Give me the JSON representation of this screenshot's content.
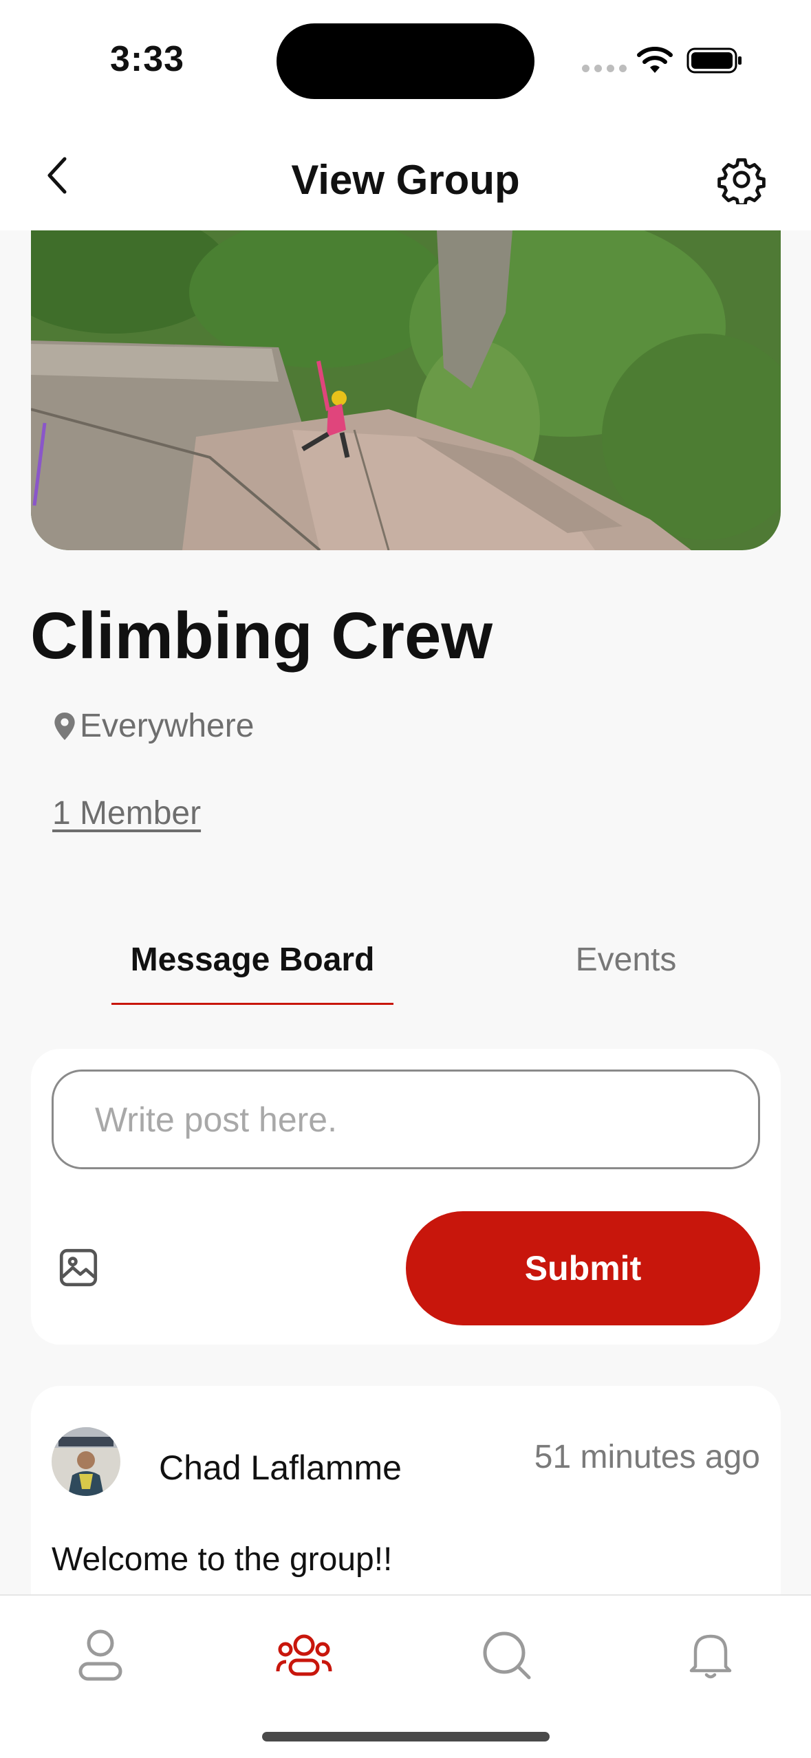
{
  "status_bar": {
    "time": "3:33"
  },
  "header": {
    "title": "View Group"
  },
  "group": {
    "name": "Climbing Crew",
    "location": "Everywhere",
    "members": "1 Member"
  },
  "tabs": [
    {
      "label": "Message Board",
      "active": true
    },
    {
      "label": "Events",
      "active": false
    }
  ],
  "composer": {
    "placeholder": "Write post here.",
    "value": "",
    "submit_label": "Submit"
  },
  "posts": [
    {
      "author": "Chad Laflamme",
      "time": "51 minutes ago",
      "body": "Welcome to the group!!"
    }
  ],
  "bottom_nav": [
    {
      "icon": "profile-icon",
      "active": false
    },
    {
      "icon": "groups-icon",
      "active": true
    },
    {
      "icon": "search-icon",
      "active": false
    },
    {
      "icon": "bell-icon",
      "active": false
    }
  ],
  "colors": {
    "accent": "#c8160c",
    "background": "#f8f8f8",
    "muted_text": "#6e6e6e"
  }
}
